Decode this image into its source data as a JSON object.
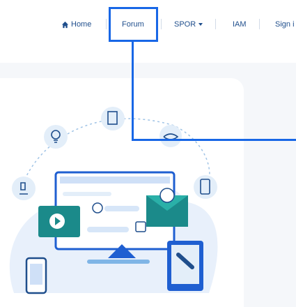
{
  "nav": {
    "home_label": "Home",
    "forum_label": "Forum",
    "spor_label": "SPOR",
    "iam_label": "IAM",
    "signin_label": "Sign i"
  },
  "colors": {
    "nav_text": "#1f4e8c",
    "highlight": "#1867e6",
    "illustration_teal": "#1b8a8a",
    "illustration_blue": "#1f5fd1"
  },
  "icons": {
    "home": "home-icon",
    "dropdown": "chevron-down-icon"
  }
}
